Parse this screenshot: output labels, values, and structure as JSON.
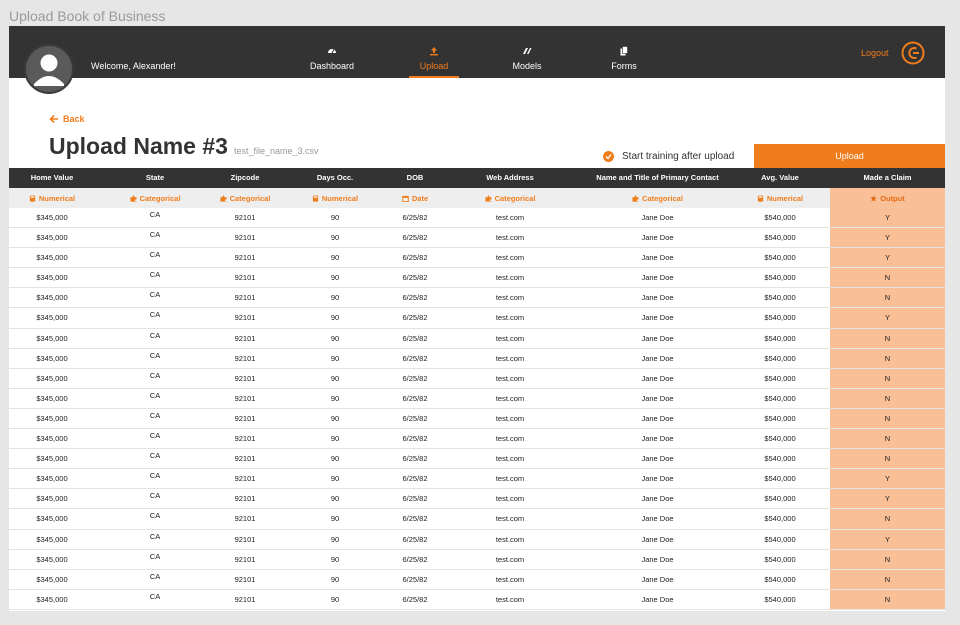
{
  "window": {
    "title": "Upload Book of Business"
  },
  "nav": {
    "welcome": "Welcome, Alexander!",
    "items": [
      {
        "label": "Dashboard",
        "icon": "gauge-icon"
      },
      {
        "label": "Upload",
        "icon": "upload-icon",
        "active": true
      },
      {
        "label": "Models",
        "icon": "models-icon"
      },
      {
        "label": "Forms",
        "icon": "forms-icon"
      }
    ],
    "logout": "Logout"
  },
  "header": {
    "back": "Back",
    "upload_name": "Upload Name #3",
    "file_name": "test_file_name_3.csv",
    "training_label": "Start training after upload",
    "upload_button": "Upload"
  },
  "colors": {
    "accent": "#f07d1c",
    "nav_bg": "#333333",
    "output_bg": "#f9bf97"
  },
  "table": {
    "columns": [
      "Home Value",
      "State",
      "Zipcode",
      "Days Occ.",
      "DOB",
      "Web Address",
      "Name and Title of Primary Contact",
      "Avg. Value",
      "Made a Claim"
    ],
    "types": [
      {
        "label": "Numerical",
        "icon": "calculator-icon"
      },
      {
        "label": "Categorical",
        "icon": "puzzle-icon"
      },
      {
        "label": "Categorical",
        "icon": "puzzle-icon"
      },
      {
        "label": "Numerical",
        "icon": "calculator-icon"
      },
      {
        "label": "Date",
        "icon": "calendar-icon"
      },
      {
        "label": "Categorical",
        "icon": "puzzle-icon"
      },
      {
        "label": "Categorical",
        "icon": "puzzle-icon"
      },
      {
        "label": "Numerical",
        "icon": "calculator-icon"
      },
      {
        "label": "Output",
        "icon": "star-icon"
      }
    ],
    "rows": [
      [
        "$345,000",
        "CA",
        "92101",
        "90",
        "6/25/82",
        "test.com",
        "Jane Doe",
        "$540,000",
        "Y"
      ],
      [
        "$345,000",
        "CA",
        "92101",
        "90",
        "6/25/82",
        "test.com",
        "Jane Doe",
        "$540,000",
        "Y"
      ],
      [
        "$345,000",
        "CA",
        "92101",
        "90",
        "6/25/82",
        "test.com",
        "Jane Doe",
        "$540,000",
        "Y"
      ],
      [
        "$345,000",
        "CA",
        "92101",
        "90",
        "6/25/82",
        "test.com",
        "Jane Doe",
        "$540,000",
        "N"
      ],
      [
        "$345,000",
        "CA",
        "92101",
        "90",
        "6/25/82",
        "test.com",
        "Jane Doe",
        "$540,000",
        "N"
      ],
      [
        "$345,000",
        "CA",
        "92101",
        "90",
        "6/25/82",
        "test.com",
        "Jane Doe",
        "$540,000",
        "Y"
      ],
      [
        "$345,000",
        "CA",
        "92101",
        "90",
        "6/25/82",
        "test.com",
        "Jane Doe",
        "$540,000",
        "N"
      ],
      [
        "$345,000",
        "CA",
        "92101",
        "90",
        "6/25/82",
        "test.com",
        "Jane Doe",
        "$540,000",
        "N"
      ],
      [
        "$345,000",
        "CA",
        "92101",
        "90",
        "6/25/82",
        "test.com",
        "Jane Doe",
        "$540,000",
        "N"
      ],
      [
        "$345,000",
        "CA",
        "92101",
        "90",
        "6/25/82",
        "test.com",
        "Jane Doe",
        "$540,000",
        "N"
      ],
      [
        "$345,000",
        "CA",
        "92101",
        "90",
        "6/25/82",
        "test.com",
        "Jane Doe",
        "$540,000",
        "N"
      ],
      [
        "$345,000",
        "CA",
        "92101",
        "90",
        "6/25/82",
        "test.com",
        "Jane Doe",
        "$540,000",
        "N"
      ],
      [
        "$345,000",
        "CA",
        "92101",
        "90",
        "6/25/82",
        "test.com",
        "Jane Doe",
        "$540,000",
        "N"
      ],
      [
        "$345,000",
        "CA",
        "92101",
        "90",
        "6/25/82",
        "test.com",
        "Jane Doe",
        "$540,000",
        "Y"
      ],
      [
        "$345,000",
        "CA",
        "92101",
        "90",
        "6/25/82",
        "test.com",
        "Jane Doe",
        "$540,000",
        "Y"
      ],
      [
        "$345,000",
        "CA",
        "92101",
        "90",
        "6/25/82",
        "test.com",
        "Jane Doe",
        "$540,000",
        "N"
      ],
      [
        "$345,000",
        "CA",
        "92101",
        "90",
        "6/25/82",
        "test.com",
        "Jane Doe",
        "$540,000",
        "Y"
      ],
      [
        "$345,000",
        "CA",
        "92101",
        "90",
        "6/25/82",
        "test.com",
        "Jane Doe",
        "$540,000",
        "N"
      ],
      [
        "$345,000",
        "CA",
        "92101",
        "90",
        "6/25/82",
        "test.com",
        "Jane Doe",
        "$540,000",
        "N"
      ],
      [
        "$345,000",
        "CA",
        "92101",
        "90",
        "6/25/82",
        "test.com",
        "Jane Doe",
        "$540,000",
        "N"
      ]
    ]
  }
}
